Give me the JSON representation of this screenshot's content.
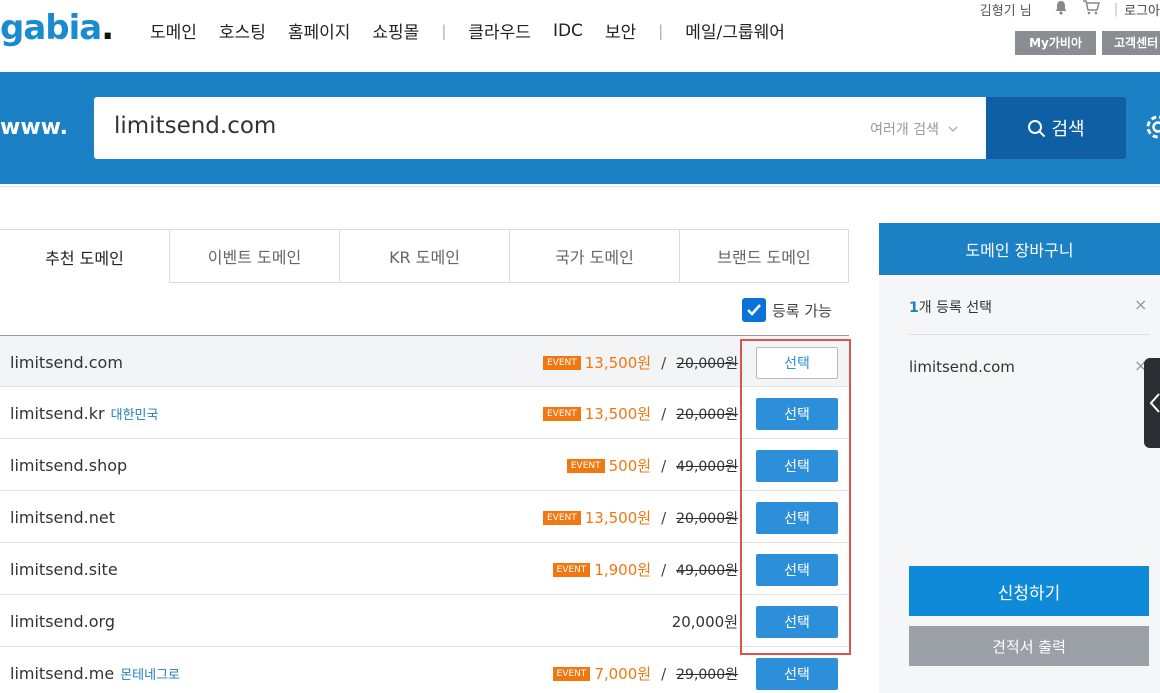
{
  "logo": {
    "text": "gabia",
    "dot": "."
  },
  "gnb": {
    "group1": [
      "도메인",
      "호스팅",
      "홈페이지",
      "쇼핑몰"
    ],
    "group2": [
      "클라우드",
      "IDC",
      "보안"
    ],
    "group3": [
      "메일/그룹웨어"
    ],
    "sep": "|"
  },
  "util": {
    "user": "김형기 님",
    "login": "로그아",
    "my_gabia": "My가비아",
    "support": "고객센터"
  },
  "search": {
    "prefix": "www.",
    "value": "limitsend.com",
    "multi_label": "여러개 검색",
    "button_label": "검색"
  },
  "tabs": [
    "추천 도메인",
    "이벤트 도메인",
    "KR 도메인",
    "국가 도메인",
    "브랜드 도메인"
  ],
  "available_label": "등록 가능",
  "domains": [
    {
      "name": "limitsend.com",
      "country": "",
      "event": "EVENT",
      "sale": "13,500원",
      "orig": "20,000원",
      "price": "",
      "button": "선택"
    },
    {
      "name": "limitsend.kr",
      "country": "대한민국",
      "event": "EVENT",
      "sale": "13,500원",
      "orig": "20,000원",
      "price": "",
      "button": "선택"
    },
    {
      "name": "limitsend.shop",
      "country": "",
      "event": "EVENT",
      "sale": "500원",
      "orig": "49,000원",
      "price": "",
      "button": "선택"
    },
    {
      "name": "limitsend.net",
      "country": "",
      "event": "EVENT",
      "sale": "13,500원",
      "orig": "20,000원",
      "price": "",
      "button": "선택"
    },
    {
      "name": "limitsend.site",
      "country": "",
      "event": "EVENT",
      "sale": "1,900원",
      "orig": "49,000원",
      "price": "",
      "button": "선택"
    },
    {
      "name": "limitsend.org",
      "country": "",
      "event": "",
      "sale": "",
      "orig": "",
      "price": "20,000원",
      "button": "선택"
    },
    {
      "name": "limitsend.me",
      "country": "몬테네그로",
      "event": "EVENT",
      "sale": "7,000원",
      "orig": "29,000원",
      "price": "",
      "button": "선택"
    }
  ],
  "cart": {
    "title": "도메인 장바구니",
    "count_num": "1",
    "count_text": "개 등록 선택",
    "item": "limitsend.com",
    "apply_label": "신청하기",
    "quote_label": "견적서 출력",
    "close": "×"
  },
  "colors": {
    "brand": "#1b81c4",
    "search_button": "#0e5fa3",
    "event": "#f07712",
    "select_button": "#2d8fda",
    "highlight_frame": "#d9534f"
  }
}
